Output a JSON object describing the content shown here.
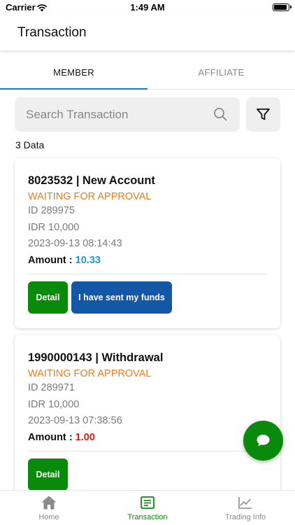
{
  "status_bar": {
    "carrier": "Carrier",
    "time": "1:49 AM"
  },
  "header": {
    "title": "Transaction"
  },
  "tabs": [
    {
      "label": "MEMBER",
      "active": true
    },
    {
      "label": "AFFILIATE",
      "active": false
    }
  ],
  "search": {
    "placeholder": "Search Transaction",
    "value": ""
  },
  "data_count": "3 Data",
  "transactions": [
    {
      "title": "8023532 | New Account",
      "status": "WAITING FOR APPROVAL",
      "id": "ID 289975",
      "currency_amount": "IDR 10,000",
      "datetime": "2023-09-13 08:14:43",
      "amount_label": "Amount :",
      "amount_value": "10.33",
      "amount_color": "#1a9ad6",
      "detail_label": "Detail",
      "sent_label": "I have sent my funds"
    },
    {
      "title": "1990000143 | Withdrawal",
      "status": "WAITING FOR APPROVAL",
      "id": "ID 289971",
      "currency_amount": "IDR 10,000",
      "datetime": "2023-09-13 07:38:56",
      "amount_label": "Amount :",
      "amount_value": "1.00",
      "amount_color": "#e01b1b",
      "detail_label": "Detail"
    }
  ],
  "bottom_nav": [
    {
      "label": "Home",
      "icon": "home-icon",
      "active": false
    },
    {
      "label": "Transaction",
      "icon": "receipt-icon",
      "active": true
    },
    {
      "label": "Trading Info",
      "icon": "chart-line-icon",
      "active": false
    }
  ],
  "colors": {
    "primary_green": "#0a8a0a",
    "primary_blue": "#1557a7",
    "tab_indicator": "#1976d2",
    "status_orange": "#e87e1e"
  }
}
